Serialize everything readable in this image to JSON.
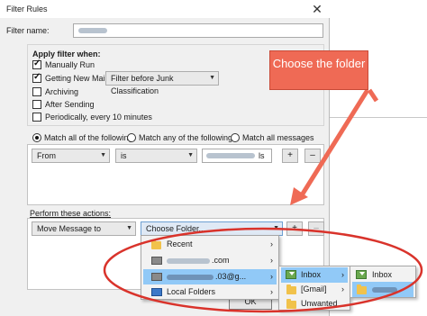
{
  "window": {
    "title": "Filter Rules",
    "close_icon": "✕"
  },
  "filter_name": {
    "label": "Filter name:",
    "value_redacted": true
  },
  "apply_when": {
    "heading": "Apply filter when:",
    "options": [
      {
        "label": "Manually Run",
        "checked": true
      },
      {
        "label": "Getting New Mail:",
        "checked": true
      },
      {
        "label": "Archiving",
        "checked": false
      },
      {
        "label": "After Sending",
        "checked": false
      },
      {
        "label": "Periodically, every 10 minutes",
        "checked": false
      }
    ],
    "new_mail_select": "Filter before Junk Classification"
  },
  "match": {
    "options": [
      {
        "label": "Match all of the following",
        "selected": true
      },
      {
        "label": "Match any of the following",
        "selected": false
      },
      {
        "label": "Match all messages",
        "selected": false
      }
    ]
  },
  "rule": {
    "field": "From",
    "operator": "is",
    "value_suffix": "ls",
    "add": "+",
    "remove": "–"
  },
  "actions": {
    "heading": "Perform these actions:",
    "action": "Move Message to",
    "target": "Choose Folder...",
    "add": "+",
    "remove": "–"
  },
  "folder_menu": {
    "items": [
      {
        "label": "Recent",
        "icon": "folder-icon",
        "has_submenu": true
      },
      {
        "label": ".com",
        "icon": "account-icon",
        "has_submenu": true
      },
      {
        "label": ".03@g...",
        "icon": "account-icon",
        "has_submenu": true,
        "highlighted": true
      },
      {
        "label": "Local Folders",
        "icon": "local-folders-icon",
        "has_submenu": true
      }
    ]
  },
  "account_submenu": {
    "items": [
      {
        "label": "Inbox",
        "icon": "inbox-icon",
        "has_submenu": true,
        "highlighted": true
      },
      {
        "label": "[Gmail]",
        "icon": "folder-icon",
        "has_submenu": true
      },
      {
        "label": "Unwanted",
        "icon": "folder-icon",
        "has_submenu": false
      }
    ]
  },
  "inbox_submenu": {
    "items": [
      {
        "label": "Inbox",
        "icon": "inbox-icon"
      },
      {
        "label": "",
        "icon": "folder-icon",
        "highlighted": true
      }
    ]
  },
  "buttons": {
    "ok": "OK"
  },
  "annotation": {
    "callout_text": "Choose the folder",
    "color": "#ef6a55"
  }
}
